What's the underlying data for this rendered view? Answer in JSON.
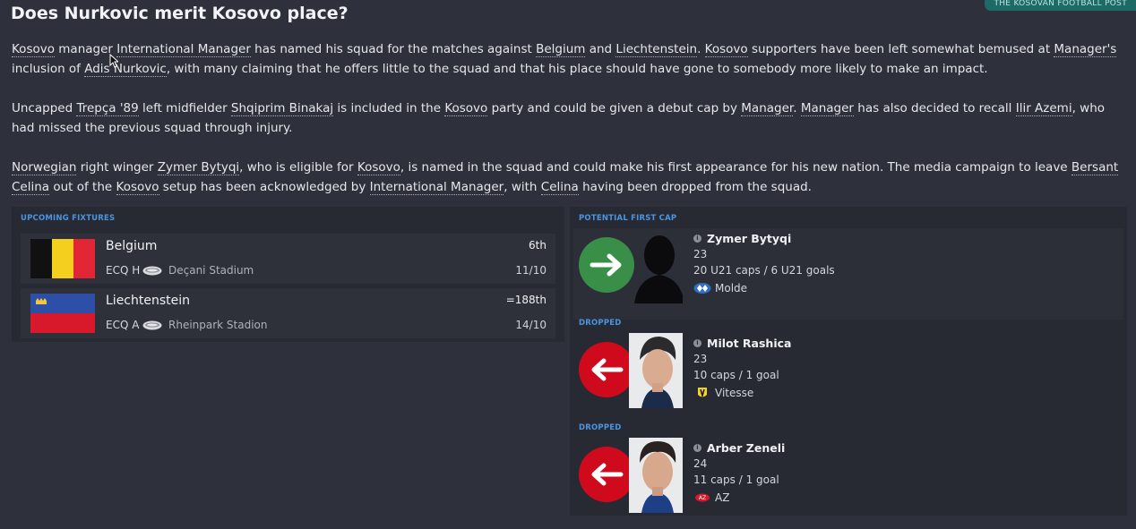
{
  "headline": "Does Nurkovic merit Kosovo place?",
  "source": "THE KOSOVAN FOOTBALL POST",
  "paragraphs": {
    "p1": [
      {
        "t": "Kosovo",
        "link": true
      },
      {
        "t": " manager "
      },
      {
        "t": "International Manager",
        "link": true
      },
      {
        "t": " has named his squad for the matches against "
      },
      {
        "t": "Belgium",
        "link": true
      },
      {
        "t": " and "
      },
      {
        "t": "Liechtenstein",
        "link": true
      },
      {
        "t": ". "
      },
      {
        "t": "Kosovo",
        "link": true
      },
      {
        "t": " supporters have been left somewhat bemused at "
      },
      {
        "t": "Manager's",
        "link": true
      },
      {
        "t": " inclusion of "
      },
      {
        "t": "Adis Nurkovic",
        "link": true
      },
      {
        "t": ", with many claiming that he offers little to the squad and that his place should have gone to somebody more likely to make an impact."
      }
    ],
    "p2": [
      {
        "t": "Uncapped "
      },
      {
        "t": "Trepça '89",
        "link": true
      },
      {
        "t": " left midfielder "
      },
      {
        "t": "Shqiprim Binakaj",
        "link": true
      },
      {
        "t": " is included in the "
      },
      {
        "t": "Kosovo",
        "link": true
      },
      {
        "t": " party and could be given a debut cap by "
      },
      {
        "t": "Manager",
        "link": true
      },
      {
        "t": ". "
      },
      {
        "t": "Manager",
        "link": true
      },
      {
        "t": " has also decided to recall "
      },
      {
        "t": "Ilir Azemi",
        "link": true
      },
      {
        "t": ", who had missed the previous squad through injury."
      }
    ],
    "p3": [
      {
        "t": "Norwegian",
        "link": true
      },
      {
        "t": " right winger "
      },
      {
        "t": "Zymer Bytyqi",
        "link": true
      },
      {
        "t": ", who is eligible for "
      },
      {
        "t": "Kosovo",
        "link": true
      },
      {
        "t": ", is named in the squad and could make his first appearance for his new nation. The media campaign to leave "
      },
      {
        "t": "Bersant Celina",
        "link": true
      },
      {
        "t": " out of the "
      },
      {
        "t": "Kosovo",
        "link": true
      },
      {
        "t": " setup has been acknowledged by "
      },
      {
        "t": "International Manager",
        "link": true
      },
      {
        "t": ", with "
      },
      {
        "t": "Celina",
        "link": true
      },
      {
        "t": " having been dropped from the squad."
      }
    ]
  },
  "fixtures": {
    "heading": "UPCOMING FIXTURES",
    "items": [
      {
        "team": "Belgium",
        "rank": "6th",
        "comp": "ECQ H",
        "venue": "Deçani Stadium",
        "date": "11/10",
        "flag": "belgium-flag"
      },
      {
        "team": "Liechtenstein",
        "rank": "=188th",
        "comp": "ECQ A",
        "venue": "Rheinpark Stadion",
        "date": "14/10",
        "flag": "liechtenstein-flag"
      }
    ]
  },
  "players": [
    {
      "heading": "POTENTIAL FIRST CAP",
      "name": "Zymer Bytyqi",
      "age": "23",
      "caps": "20 U21 caps / 6 U21 goals",
      "club": "Molde",
      "direction": "in",
      "arrow_color": "#3a8f48",
      "club_icon": "molde-crest-icon"
    },
    {
      "heading": "DROPPED",
      "name": "Milot Rashica",
      "age": "23",
      "caps": "10 caps / 1 goal",
      "club": "Vitesse",
      "direction": "out",
      "arrow_color": "#cf0a1c",
      "club_icon": "vitesse-crest-icon"
    },
    {
      "heading": "DROPPED",
      "name": "Arber Zeneli",
      "age": "24",
      "caps": "11 caps / 1 goal",
      "club": "AZ",
      "direction": "out",
      "arrow_color": "#cf0a1c",
      "club_icon": "az-crest-icon"
    }
  ]
}
